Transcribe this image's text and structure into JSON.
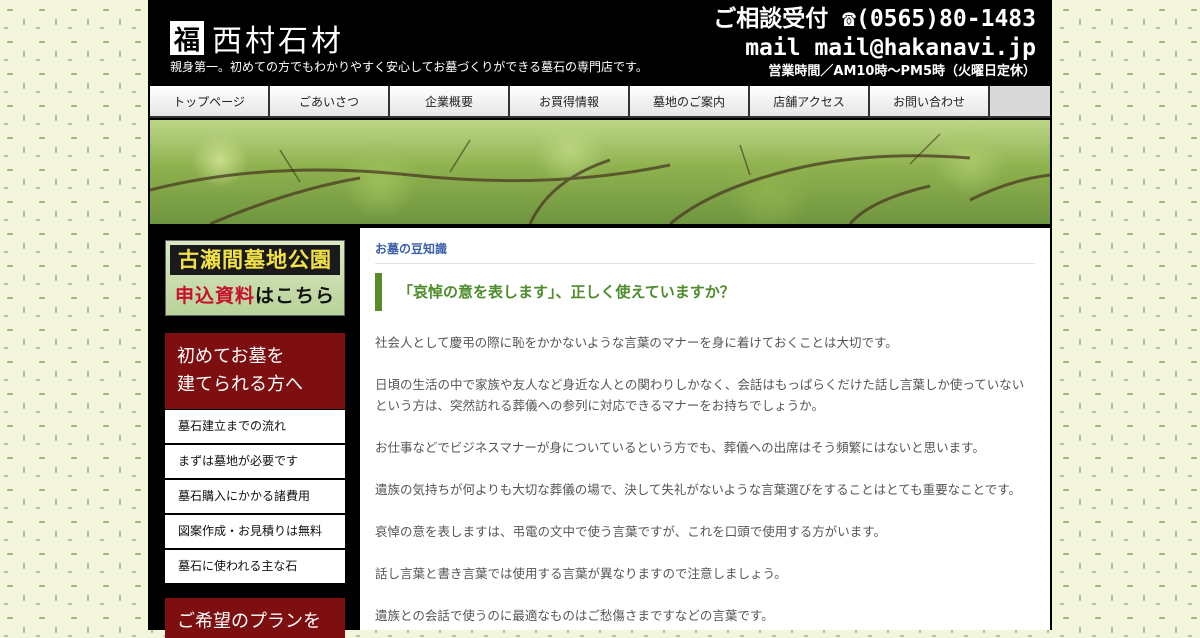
{
  "header": {
    "logo_mark": "福",
    "logo_text": "西村石材",
    "tagline": "親身第一。初めての方でもわかりやすく安心してお墓づくりができる墓石の専門店です。",
    "tel": "ご相談受付 ☎(0565)80-1483",
    "mail": "mail mail@hakanavi.jp",
    "hours": "営業時間／AM10時〜PM5時（火曜日定休）"
  },
  "nav": [
    "トップページ",
    "ごあいさつ",
    "企業概要",
    "お買得情報",
    "墓地のご案内",
    "店舗アクセス",
    "お問い合わせ"
  ],
  "sidebar": {
    "banner": {
      "line1": "古瀬間墓地公園",
      "line2_red": "申込資料",
      "line2_black": "はこちら"
    },
    "guide_title_line1": "初めてお墓を",
    "guide_title_line2": "建てられる方へ",
    "menu": [
      "墓石建立までの流れ",
      "まずは墓地が必要です",
      "墓石購入にかかる諸費用",
      "図案作成・お見積りは無料",
      "墓石に使われる主な石"
    ],
    "plan_title": "ご希望のプランを"
  },
  "main": {
    "category": "お墓の豆知識",
    "title": "「哀悼の意を表します」、正しく使えていますか？",
    "paragraphs": [
      "社会人として慶弔の際に恥をかかないような言葉のマナーを身に着けておくことは大切です。",
      "日頃の生活の中で家族や友人など身近な人との関わりしかなく、会話はもっぱらくだけた話し言葉しか使っていないという方は、突然訪れる葬儀への参列に対応できるマナーをお持ちでしょうか。",
      "お仕事などでビジネスマナーが身についているという方でも、葬儀への出席はそう頻繁にはないと思います。",
      "遺族の気持ちが何よりも大切な葬儀の場で、決して失礼がないような言葉選びをすることはとても重要なことです。",
      "哀悼の意を表しますは、弔電の文中で使う言葉ですが、これを口頭で使用する方がいます。",
      "話し言葉と書き言葉では使用する言葉が異なりますので注意しましょう。",
      "遺族との会話で使うのに最適なものはご愁傷さまですなどの言葉です。"
    ]
  }
}
